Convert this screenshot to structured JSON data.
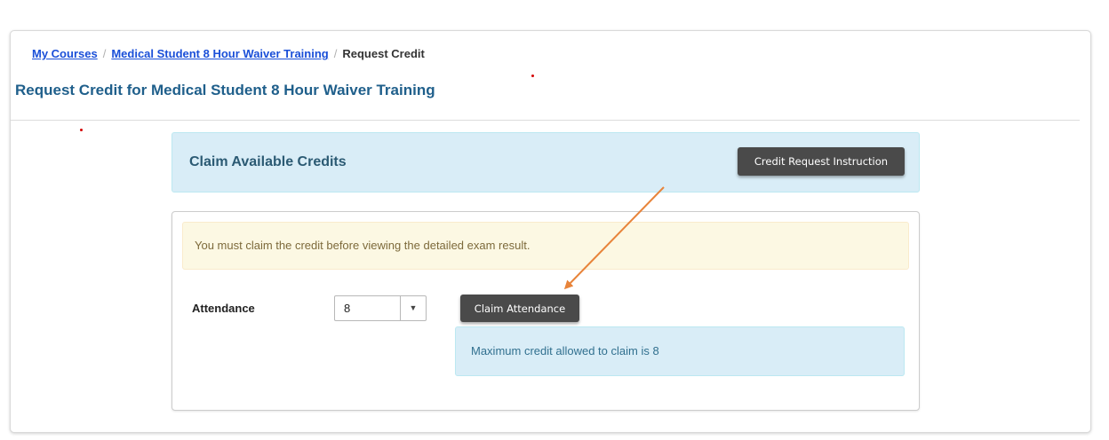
{
  "breadcrumb": {
    "my_courses": "My Courses",
    "course": "Medical Student 8 Hour Waiver Training",
    "current": "Request Credit",
    "separator": "/"
  },
  "page_title": "Request Credit for Medical Student 8 Hour Waiver Training",
  "claim_section": {
    "title": "Claim Available Credits",
    "instruction_button": "Credit Request Instruction"
  },
  "warning_message": "You must claim the credit before viewing the detailed exam result.",
  "attendance": {
    "label": "Attendance",
    "selected_value": "8",
    "claim_button": "Claim Attendance",
    "info_message": "Maximum credit allowed to claim is 8"
  },
  "colors": {
    "link": "#1a4fd8",
    "title": "#1f5f8b",
    "info_bg": "#d9edf7",
    "warning_bg": "#fcf8e3",
    "dark_button": "#4a4a4a",
    "annotation_arrow": "#e8843a"
  },
  "icons": {
    "dropdown": "caret-down-icon",
    "annotation": "arrow-annotation-icon"
  }
}
